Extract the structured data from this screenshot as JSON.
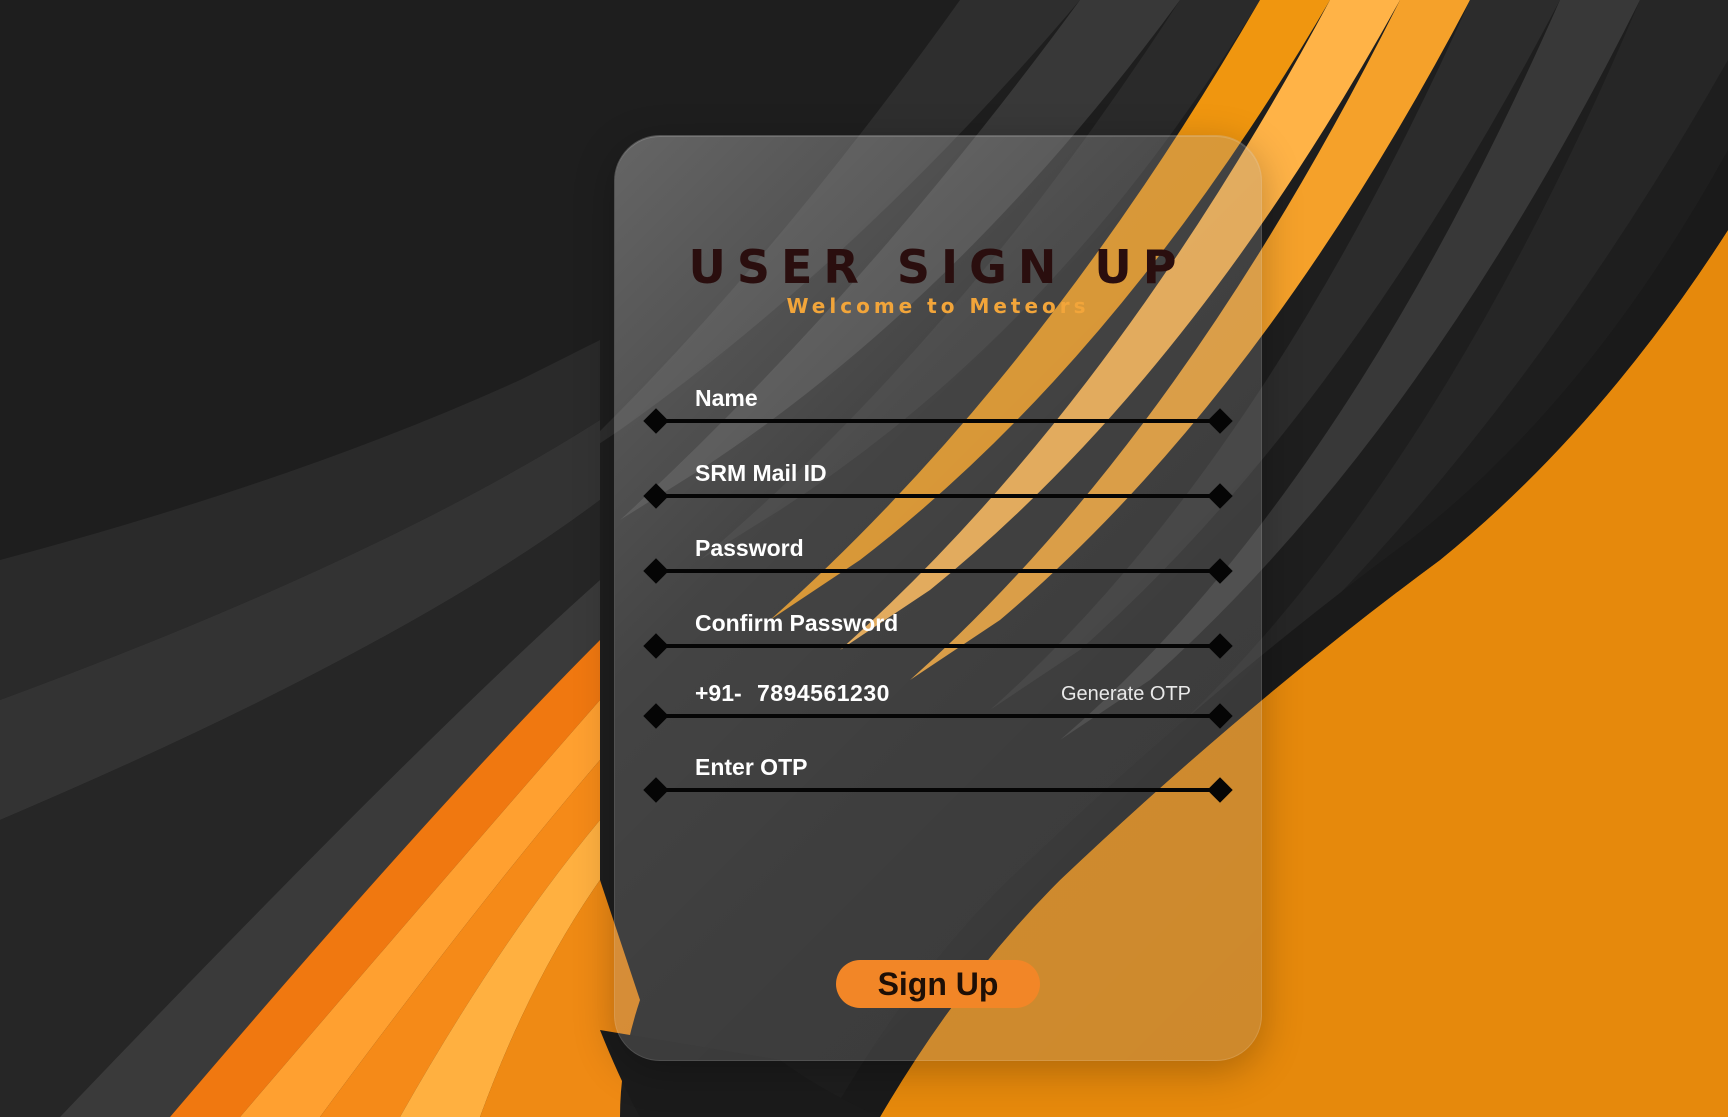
{
  "colors": {
    "background_dark": "#1d1d1d",
    "accent_orange": "#e6890c",
    "title_color": "#2a0e0e",
    "subtitle_color": "#f2a53a",
    "button_color": "#f28627"
  },
  "form": {
    "title": "USER SIGN UP",
    "subtitle": "Welcome to Meteors",
    "fields": {
      "name": {
        "label": "Name"
      },
      "mail": {
        "label": "SRM Mail ID"
      },
      "password": {
        "label": "Password"
      },
      "confirm_password": {
        "label": "Confirm Password"
      },
      "phone": {
        "prefix": "+91-",
        "value": "7894561230",
        "action_label": "Generate OTP"
      },
      "otp": {
        "label": "Enter OTP"
      }
    },
    "submit_label": "Sign Up"
  }
}
